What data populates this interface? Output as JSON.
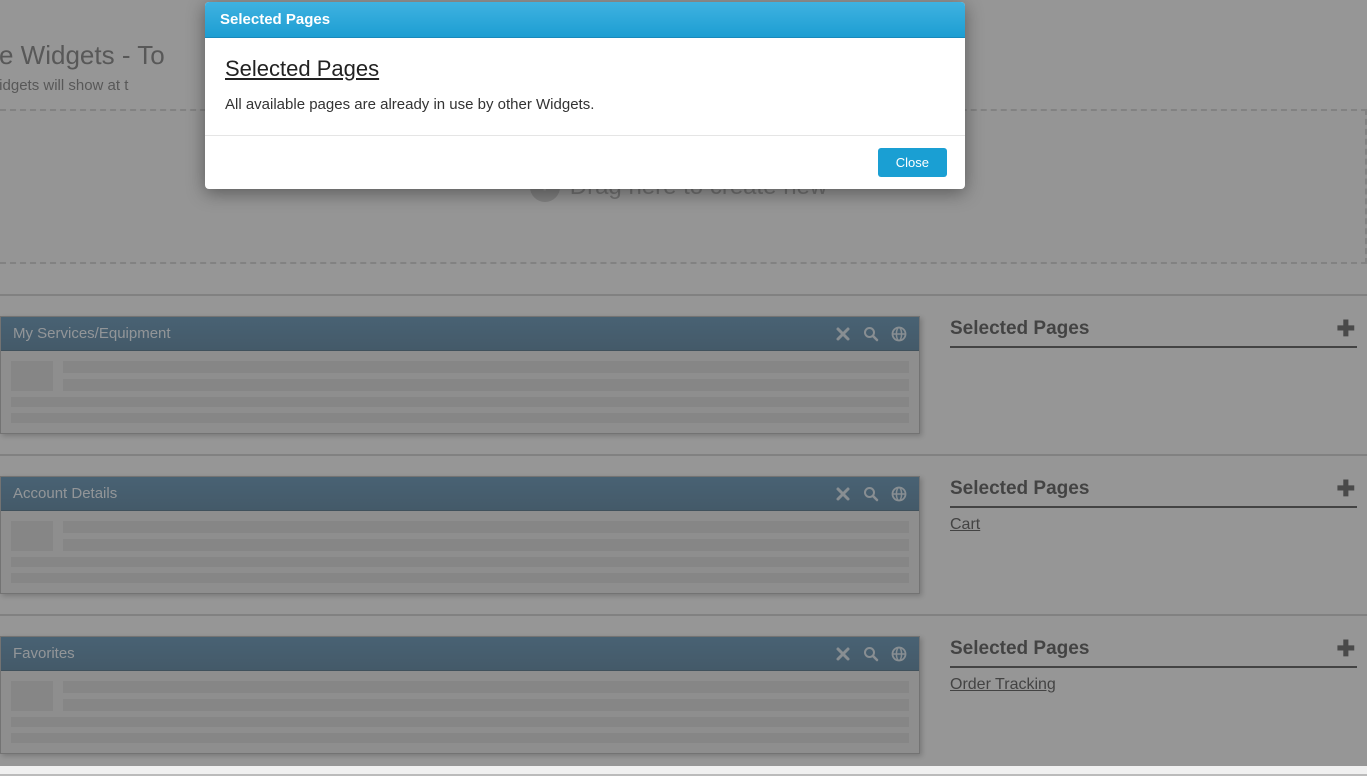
{
  "section": {
    "title_partial": "ctive Widgets - To",
    "subtitle_partial": "ese widgets will show at t"
  },
  "dropzone": {
    "label": "Drag here to create new"
  },
  "widgets": [
    {
      "title": "My Services/Equipment",
      "side_heading": "Selected Pages",
      "pages": []
    },
    {
      "title": "Account Details",
      "side_heading": "Selected Pages",
      "pages": [
        "Cart"
      ]
    },
    {
      "title": "Favorites",
      "side_heading": "Selected Pages",
      "pages": [
        "Order Tracking"
      ]
    }
  ],
  "modal": {
    "header": "Selected Pages",
    "body_title": "Selected Pages",
    "body_text": "All available pages are already in use by other Widgets.",
    "close_label": "Close"
  }
}
